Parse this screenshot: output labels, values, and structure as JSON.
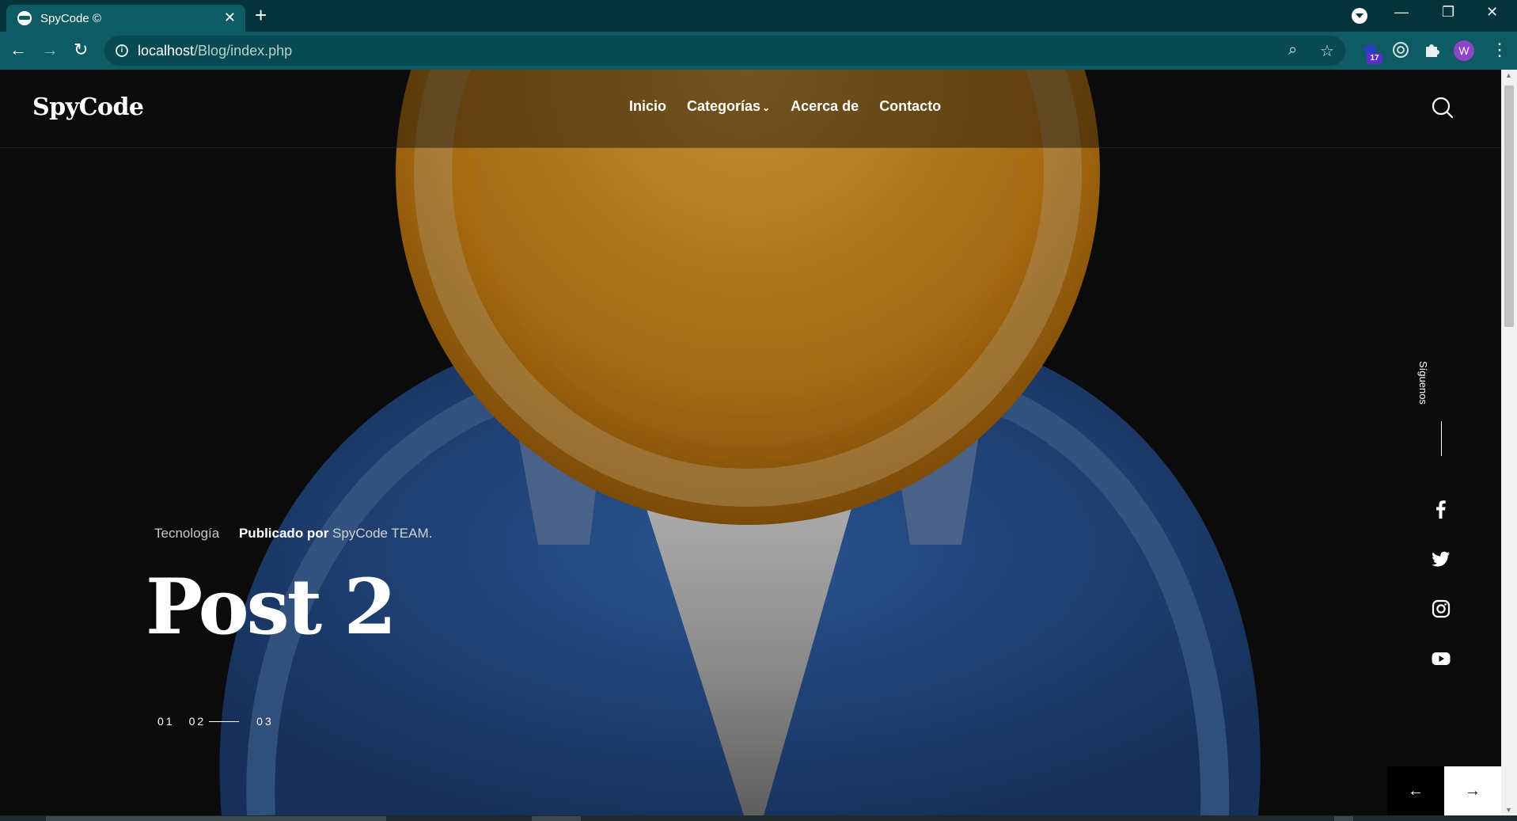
{
  "browser": {
    "tab_title": "SpyCode ©",
    "url_host": "localhost",
    "url_path": "/Blog/index.php",
    "extension_badge": "17",
    "profile_initial": "W"
  },
  "header": {
    "logo": "SpyCode",
    "nav": [
      {
        "label": "Inicio"
      },
      {
        "label": "Categorías"
      },
      {
        "label": "Acerca de"
      },
      {
        "label": "Contacto"
      }
    ]
  },
  "hero": {
    "category": "Tecnología",
    "published_label": "Publicado por",
    "author": "SpyCode TEAM.",
    "title": "Post 2",
    "pages": [
      "01",
      "02",
      "03"
    ],
    "follow_label": "Síguenos"
  },
  "social": [
    "facebook-icon",
    "twitter-icon",
    "instagram-icon",
    "youtube-icon"
  ],
  "colors": {
    "tab_bar": "#04333a",
    "toolbar": "#0f5b63",
    "page_bg": "#0b0b0b",
    "head_orange": "#b97a1c",
    "body_blue": "#1e3f73"
  }
}
